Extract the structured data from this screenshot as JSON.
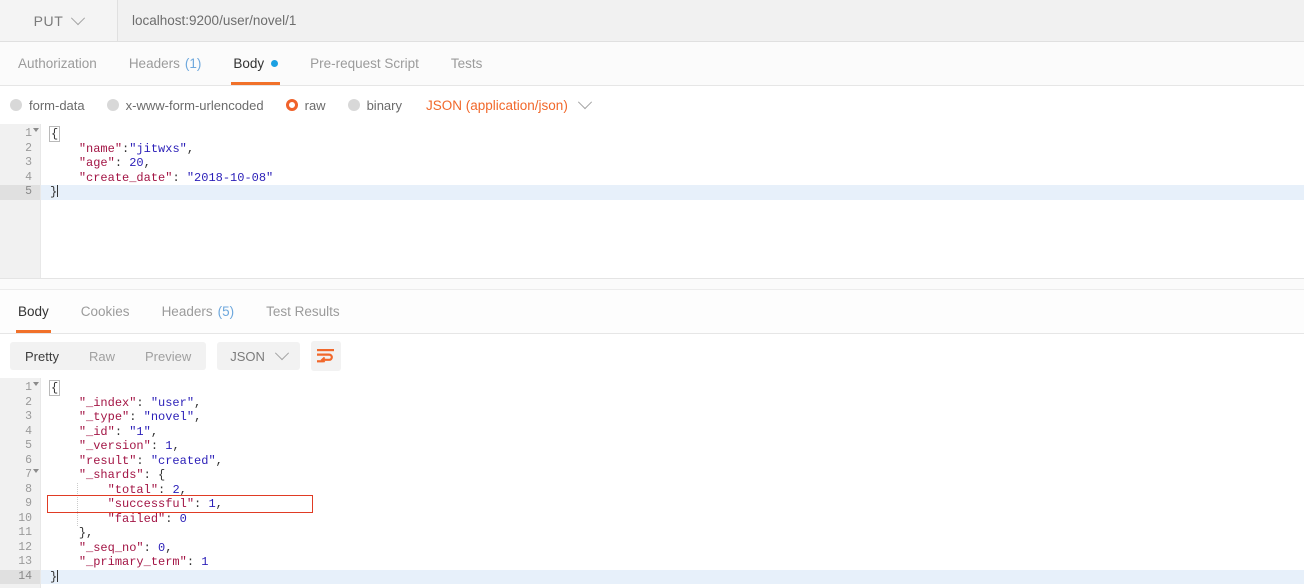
{
  "request": {
    "method": "PUT",
    "url": "localhost:9200/user/novel/1",
    "tabs": [
      {
        "label": "Authorization",
        "active": false,
        "count": null,
        "dot": false
      },
      {
        "label": "Headers",
        "active": false,
        "count": "(1)",
        "dot": false
      },
      {
        "label": "Body",
        "active": true,
        "count": null,
        "dot": true
      },
      {
        "label": "Pre-request Script",
        "active": false,
        "count": null,
        "dot": false
      },
      {
        "label": "Tests",
        "active": false,
        "count": null,
        "dot": false
      }
    ],
    "body_types": [
      {
        "label": "form-data",
        "selected": false
      },
      {
        "label": "x-www-form-urlencoded",
        "selected": false
      },
      {
        "label": "raw",
        "selected": true
      },
      {
        "label": "binary",
        "selected": false
      }
    ],
    "content_type": "JSON (application/json)",
    "code_lines": [
      {
        "num": "1",
        "fold": true,
        "text": "{",
        "cursor_line": false
      },
      {
        "num": "2",
        "fold": false,
        "text": "    \"name\":\"jitwxs\",",
        "cursor_line": false
      },
      {
        "num": "3",
        "fold": false,
        "text": "    \"age\": 20,",
        "cursor_line": false
      },
      {
        "num": "4",
        "fold": false,
        "text": "    \"create_date\": \"2018-10-08\"",
        "cursor_line": false
      },
      {
        "num": "5",
        "fold": false,
        "text": "}",
        "cursor_line": true
      }
    ]
  },
  "response": {
    "tabs": [
      {
        "label": "Body",
        "active": true,
        "count": null
      },
      {
        "label": "Cookies",
        "active": false,
        "count": null
      },
      {
        "label": "Headers",
        "active": false,
        "count": "(5)"
      },
      {
        "label": "Test Results",
        "active": false,
        "count": null
      }
    ],
    "view_modes": [
      {
        "label": "Pretty",
        "active": true
      },
      {
        "label": "Raw",
        "active": false
      },
      {
        "label": "Preview",
        "active": false
      }
    ],
    "format": "JSON",
    "wrap_icon": "word-wrap-icon",
    "code_lines": [
      {
        "num": "1",
        "fold": true,
        "text": "{",
        "cursor_line": false
      },
      {
        "num": "2",
        "fold": false,
        "text": "    \"_index\": \"user\",",
        "cursor_line": false
      },
      {
        "num": "3",
        "fold": false,
        "text": "    \"_type\": \"novel\",",
        "cursor_line": false
      },
      {
        "num": "4",
        "fold": false,
        "text": "    \"_id\": \"1\",",
        "cursor_line": false
      },
      {
        "num": "5",
        "fold": false,
        "text": "    \"_version\": 1,",
        "cursor_line": false
      },
      {
        "num": "6",
        "fold": false,
        "text": "    \"result\": \"created\",",
        "cursor_line": false
      },
      {
        "num": "7",
        "fold": true,
        "text": "    \"_shards\": {",
        "cursor_line": false
      },
      {
        "num": "8",
        "fold": false,
        "text": "        \"total\": 2,",
        "cursor_line": false
      },
      {
        "num": "9",
        "fold": false,
        "text": "        \"successful\": 1,",
        "cursor_line": false,
        "annotated": true
      },
      {
        "num": "10",
        "fold": false,
        "text": "        \"failed\": 0",
        "cursor_line": false
      },
      {
        "num": "11",
        "fold": false,
        "text": "    },",
        "cursor_line": false
      },
      {
        "num": "12",
        "fold": false,
        "text": "    \"_seq_no\": 0,",
        "cursor_line": false
      },
      {
        "num": "13",
        "fold": false,
        "text": "    \"_primary_term\": 1",
        "cursor_line": false
      },
      {
        "num": "14",
        "fold": false,
        "text": "}",
        "cursor_line": true
      }
    ]
  },
  "colors": {
    "accent_orange": "#f1682b",
    "annotation_red": "#e03b24",
    "key_color": "#a31545",
    "value_color": "#2b1fb8",
    "dot_blue": "#1ba0e2",
    "active_line": "#e7f0fa"
  }
}
